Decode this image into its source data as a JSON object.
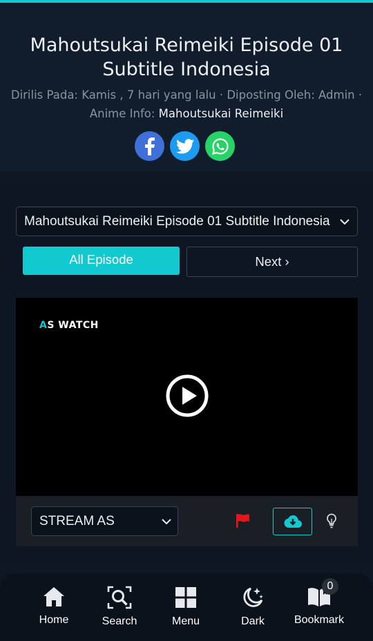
{
  "accent_color": "#12c9d0",
  "post": {
    "title": "Mahoutsukai Reimeiki Episode 01 Subtitle Indonesia",
    "released_label": "Dirilis Pada:",
    "released_value": "Kamis , 7 hari yang lalu",
    "posted_label": "Diposting Oleh:",
    "posted_value": "Admin",
    "anime_info_label": "Anime Info:",
    "anime_info_value": "Mahoutsukai Reimeiki",
    "separator": "·"
  },
  "share": [
    "facebook-icon",
    "twitter-icon",
    "whatsapp-icon"
  ],
  "episode_select": {
    "selected": "Mahoutsukai Reimeiki Episode 01 Subtitle Indonesia"
  },
  "buttons": {
    "all_episode": "All Episode",
    "next": "Next ›"
  },
  "player": {
    "logo_a": "A",
    "logo_rest": "S WATCH",
    "play_icon": "play-icon"
  },
  "controls": {
    "server_selected": "STREAM AS",
    "icons": [
      "flag-icon",
      "cloud-download-icon",
      "lightbulb-icon"
    ]
  },
  "bottom_nav": {
    "items": [
      {
        "label": "Home",
        "icon": "home-icon"
      },
      {
        "label": "Search",
        "icon": "search-icon"
      },
      {
        "label": "Menu",
        "icon": "grid-icon"
      },
      {
        "label": "Dark",
        "icon": "moon-icon"
      },
      {
        "label": "Bookmark",
        "icon": "bookmark-icon"
      }
    ],
    "bookmark_count": "0"
  }
}
